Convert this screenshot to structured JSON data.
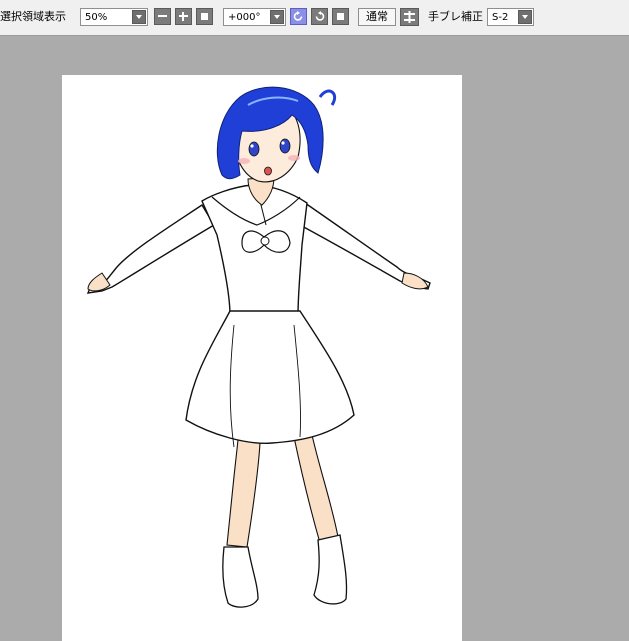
{
  "toolbar": {
    "selection_display_label": "選択領域表示",
    "zoom_value": "50%",
    "rotation_value": "+000°",
    "blend_mode_button": "通常",
    "stabilizer_label": "手ブレ補正",
    "stabilizer_value": "S-2"
  },
  "icons": {
    "zoom_out": "minus-icon",
    "zoom_in": "plus-icon",
    "zoom_reset": "square-icon",
    "rotate_left": "rotate-ccw-icon",
    "rotate_right": "rotate-cw-icon",
    "rotate_reset": "square-icon",
    "flip": "flip-horizontal-icon"
  },
  "colors": {
    "workspace": "#ababab",
    "toolbar": "#f0f0f0",
    "active_button": "#8a8fe8",
    "hair": "#1f3fd6"
  }
}
